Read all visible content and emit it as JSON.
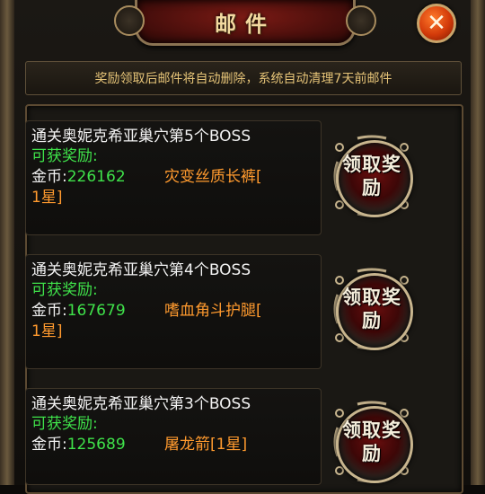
{
  "header": {
    "title": "邮件"
  },
  "notice": {
    "text": "奖励领取后邮件将自动删除，系统自动清理7天前邮件"
  },
  "mails": [
    {
      "title": "通关奥妮克希亚巢穴第5个BOSS",
      "reward_label": "可获奖励:",
      "gold_key": "金币:",
      "gold_value": "226162",
      "item_line1": "灾变丝质长裤[",
      "item_line2": "1星]",
      "claim_label": "领取奖励"
    },
    {
      "title": "通关奥妮克希亚巢穴第4个BOSS",
      "reward_label": "可获奖励:",
      "gold_key": "金币:",
      "gold_value": "167679",
      "item_line1": "嗜血角斗护腿[",
      "item_line2": "1星]",
      "claim_label": "领取奖励"
    },
    {
      "title": "通关奥妮克希亚巢穴第3个BOSS",
      "reward_label": "可获奖励:",
      "gold_key": "金币:",
      "gold_value": "125689",
      "item_line1": "屠龙箭[1星]",
      "item_line2": "",
      "claim_label": "领取奖励"
    }
  ],
  "icons": {
    "close": "close-icon"
  },
  "colors": {
    "reward_green": "#3fe24a",
    "item_orange": "#ff9a2e",
    "notice_gold": "#e6c478"
  }
}
